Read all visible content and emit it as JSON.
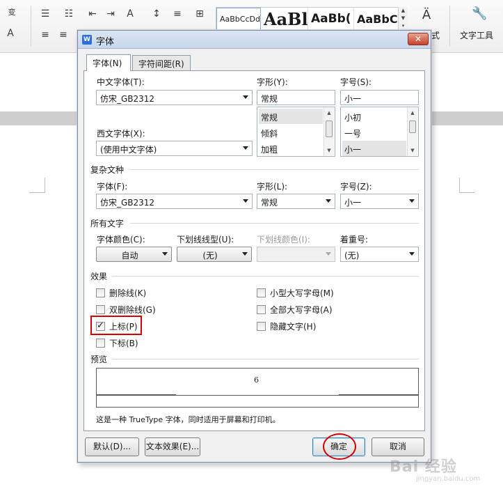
{
  "ribbon": {
    "style_samples": [
      "AaBbCcDd",
      "AaBl",
      "AaBb(",
      "AaBbC("
    ],
    "text_tools_label": "文字工具",
    "partial_label": "式"
  },
  "dialog": {
    "title": "字体",
    "close_label": "✕",
    "tabs": [
      {
        "label": "字体(N)",
        "active": true
      },
      {
        "label": "字符间距(R)",
        "active": false
      }
    ],
    "chinese_font": {
      "label": "中文字体(T):",
      "value": "仿宋_GB2312"
    },
    "style": {
      "label": "字形(Y):",
      "value": "常规",
      "options": [
        "常规",
        "倾斜",
        "加粗"
      ],
      "selected": "常规"
    },
    "size": {
      "label": "字号(S):",
      "value": "小一",
      "options": [
        "小初",
        "一号",
        "小一"
      ],
      "selected": "小一"
    },
    "western_font": {
      "label": "西文字体(X):",
      "value": "(使用中文字体)"
    },
    "complex": {
      "group_title": "复杂文种",
      "font": {
        "label": "字体(F):",
        "value": "仿宋_GB2312"
      },
      "style": {
        "label": "字形(L):",
        "value": "常规"
      },
      "size": {
        "label": "字号(Z):",
        "value": "小一"
      }
    },
    "all_text": {
      "group_title": "所有文字",
      "font_color": {
        "label": "字体颜色(C):",
        "value": "自动"
      },
      "underline_type": {
        "label": "下划线线型(U):",
        "value": "(无)"
      },
      "underline_color": {
        "label": "下划线颜色(I):",
        "value": ""
      },
      "emphasis": {
        "label": "着重号:",
        "value": "(无)"
      }
    },
    "effects": {
      "group_title": "效果",
      "strikethrough": {
        "label": "删除线(K)",
        "checked": false
      },
      "double_strikethrough": {
        "label": "双删除线(G)",
        "checked": false
      },
      "superscript": {
        "label": "上标(P)",
        "checked": true
      },
      "subscript": {
        "label": "下标(B)",
        "checked": false
      },
      "small_caps": {
        "label": "小型大写字母(M)",
        "checked": false
      },
      "all_caps": {
        "label": "全部大写字母(A)",
        "checked": false
      },
      "hidden": {
        "label": "隐藏文字(H)",
        "checked": false
      }
    },
    "preview": {
      "group_title": "预览",
      "sample": "6",
      "description": "这是一种 TrueType 字体，同时适用于屏幕和打印机。"
    },
    "buttons": {
      "default": "默认(D)...",
      "text_effects": "文本效果(E)...",
      "ok": "确定",
      "cancel": "取消"
    },
    "colors": {
      "highlight": "#d40000",
      "title_bar": "#c8d7ec",
      "close": "#c7402a"
    }
  },
  "watermark": {
    "main": "Bai 经验",
    "sub": "jingyan.baidu.com"
  }
}
